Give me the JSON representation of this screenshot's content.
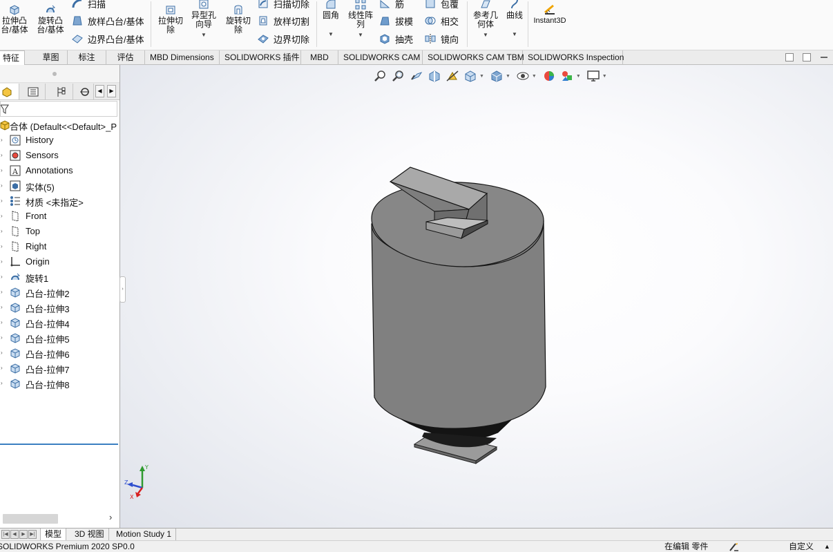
{
  "ribbon": {
    "extrude_boss": "拉伸凸\n台/基体",
    "revolve_boss": "旋转凸\n台/基体",
    "sweep": "扫描",
    "loft_boss": "放样凸台/基体",
    "boundary_boss": "边界凸台/基体",
    "extrude_cut": "拉伸切\n除",
    "hole_wizard": "异型孔\n向导",
    "revolve_cut": "旋转切\n除",
    "sweep_cut": "扫描切除",
    "loft_cut": "放样切割",
    "boundary_cut": "边界切除",
    "fillet": "圆角",
    "linear_pattern": "线性阵\n列",
    "rib": "筋",
    "draft": "拔模",
    "shell": "抽壳",
    "wrap": "包覆",
    "intersect": "相交",
    "mirror": "镜向",
    "ref_geometry": "参考几\n何体",
    "curves": "曲线",
    "instant3d": "Instant3D"
  },
  "command_tabs": [
    "特征",
    "草图",
    "标注",
    "评估",
    "MBD Dimensions",
    "SOLIDWORKS 插件",
    "MBD",
    "SOLIDWORKS CAM",
    "SOLIDWORKS CAM TBM",
    "SOLIDWORKS Inspection"
  ],
  "tree": {
    "root": "合体  (Default<<Default>_P",
    "items": [
      {
        "label": "History",
        "icon": "history-icon"
      },
      {
        "label": "Sensors",
        "icon": "sensors-icon"
      },
      {
        "label": "Annotations",
        "icon": "annotations-icon"
      },
      {
        "label": "实体(5)",
        "icon": "solid-bodies-icon"
      },
      {
        "label": "材质 <未指定>",
        "icon": "material-icon"
      },
      {
        "label": "Front",
        "icon": "plane-icon"
      },
      {
        "label": "Top",
        "icon": "plane-icon"
      },
      {
        "label": "Right",
        "icon": "plane-icon"
      },
      {
        "label": "Origin",
        "icon": "origin-icon"
      },
      {
        "label": "旋转1",
        "icon": "revolve-feature-icon"
      },
      {
        "label": "凸台-拉伸2",
        "icon": "extrude-feature-icon"
      },
      {
        "label": "凸台-拉伸3",
        "icon": "extrude-feature-icon"
      },
      {
        "label": "凸台-拉伸4",
        "icon": "extrude-feature-icon"
      },
      {
        "label": "凸台-拉伸5",
        "icon": "extrude-feature-icon"
      },
      {
        "label": "凸台-拉伸6",
        "icon": "extrude-feature-icon"
      },
      {
        "label": "凸台-拉伸7",
        "icon": "extrude-feature-icon"
      },
      {
        "label": "凸台-拉伸8",
        "icon": "extrude-feature-icon"
      }
    ]
  },
  "bottom_tabs": [
    "模型",
    "3D 视图",
    "Motion Study 1"
  ],
  "status": {
    "product": "SOLIDWORKS Premium 2020 SP0.0",
    "editing": "在编辑 零件",
    "units": "自定义"
  },
  "triad": {
    "x": "X",
    "y": "Y",
    "z": "Z"
  },
  "colors": {
    "accent": "#3a7fc1",
    "model_gray": "#7a7a7a",
    "viewport_bg": "#f5f6f9"
  }
}
